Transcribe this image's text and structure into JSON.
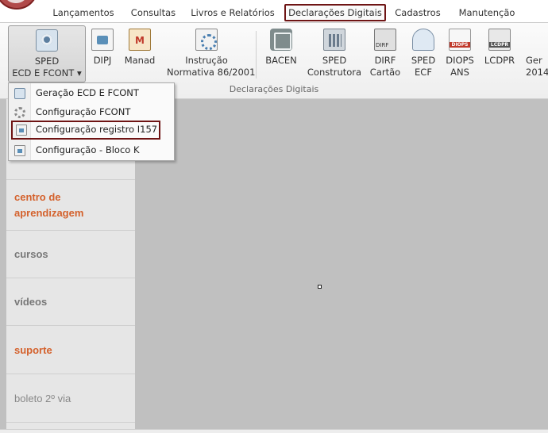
{
  "tabs": [
    {
      "label": "Lançamentos",
      "active": false
    },
    {
      "label": "Consultas",
      "active": false
    },
    {
      "label": "Livros e Relatórios",
      "active": false
    },
    {
      "label": "Declarações Digitais",
      "active": true
    },
    {
      "label": "Cadastros",
      "active": false
    },
    {
      "label": "Manutenção",
      "active": false
    }
  ],
  "ribbon": {
    "group_label": "Declarações Digitais",
    "buttons": [
      {
        "line1": "SPED",
        "line2": "ECD E FCONT ▾",
        "icon": "sped-icon"
      },
      {
        "line1": "DIPJ",
        "line2": "",
        "icon": "dipj-icon"
      },
      {
        "line1": "Manad",
        "line2": "",
        "icon": "manad-icon"
      },
      {
        "line1": "Instrução",
        "line2": "Normativa 86/2001",
        "icon": "instrucao-icon"
      },
      {
        "line1": "BACEN",
        "line2": "",
        "icon": "bacen-icon"
      },
      {
        "line1": "SPED",
        "line2": "Construtora",
        "icon": "construtora-icon"
      },
      {
        "line1": "DIRF",
        "line2": "Cartão",
        "icon": "dirf-icon"
      },
      {
        "line1": "SPED",
        "line2": "ECF",
        "icon": "ecf-icon"
      },
      {
        "line1": "DIOPS",
        "line2": "ANS",
        "icon": "diops-icon"
      },
      {
        "line1": "LCDPR",
        "line2": "",
        "icon": "lcdpr-icon"
      },
      {
        "line1": "Ger",
        "line2": "2014",
        "icon": ""
      }
    ]
  },
  "dropdown": {
    "items": [
      {
        "label": "Geração ECD E FCONT",
        "icon": "sped-icon",
        "highlighted": false
      },
      {
        "label": "Configuração FCONT",
        "icon": "gear-icon",
        "highlighted": false
      },
      {
        "label": "Configuração registro I157",
        "icon": "document-icon",
        "highlighted": true
      },
      {
        "label": "Configuração - Bloco K",
        "icon": "document-icon",
        "highlighted": false
      }
    ]
  },
  "sidebar": {
    "items": [
      {
        "label": "centro de aprendizagem",
        "style": "accent"
      },
      {
        "label": "cursos",
        "style": "muted"
      },
      {
        "label": "vídeos",
        "style": "muted"
      },
      {
        "label": "suporte",
        "style": "accent"
      },
      {
        "label": "boleto 2º via",
        "style": "normal"
      }
    ]
  },
  "colors": {
    "highlight_border": "#6e1414",
    "accent_text": "#d4612c",
    "workspace": "#c0c0c0"
  }
}
